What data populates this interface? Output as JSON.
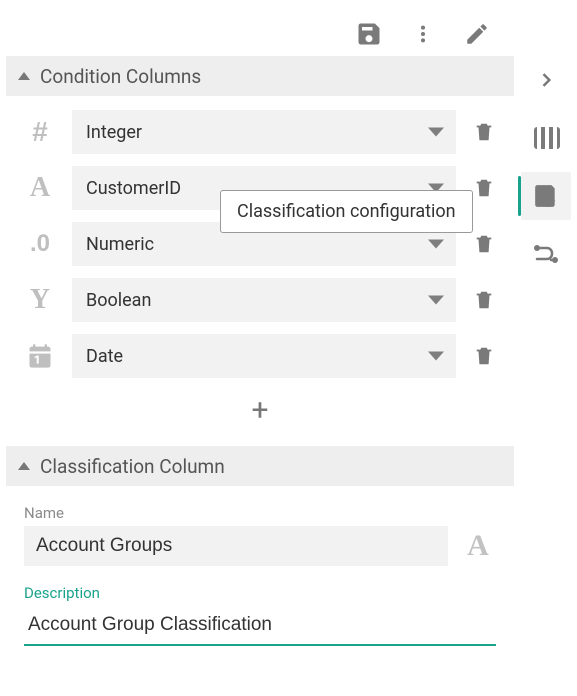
{
  "toolbar": {
    "save": "Save",
    "more": "More",
    "edit": "Edit"
  },
  "rail": {
    "items": [
      "expand",
      "columns",
      "classification",
      "flow"
    ],
    "activeIndex": 2,
    "tooltip": "Classification configuration"
  },
  "sections": {
    "conditions": {
      "title": "Condition Columns",
      "rows": [
        {
          "icon": "hash",
          "label": "Integer"
        },
        {
          "icon": "letterA",
          "label": "CustomerID"
        },
        {
          "icon": "decimal",
          "label": "Numeric"
        },
        {
          "icon": "letterY",
          "label": "Boolean"
        },
        {
          "icon": "calendar",
          "label": "Date"
        }
      ],
      "add": "+"
    },
    "classification": {
      "title": "Classification Column",
      "nameLabel": "Name",
      "nameValue": "Account Groups",
      "descLabel": "Description",
      "descValue": "Account Group Classification"
    }
  }
}
